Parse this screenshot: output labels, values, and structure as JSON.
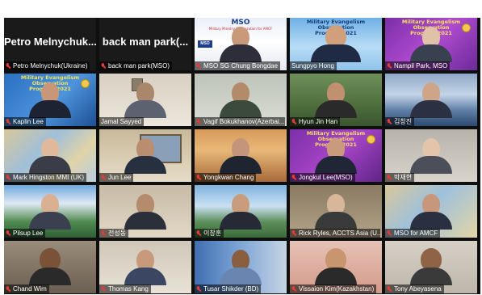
{
  "meeting": {
    "participants": [
      {
        "id": "p1",
        "label": "Petro Melnychuk(Ukraine)",
        "display_name": "Petro Melnychuk...",
        "video": false
      },
      {
        "id": "p2",
        "label": "back man park(MSO)",
        "display_name": "back man park(...",
        "video": false
      },
      {
        "id": "p3",
        "label": "MSO SG Chung Bongdae",
        "video": true,
        "banner_title": "MSO",
        "banner_sub": "Military Ministry Organization for AMCF"
      },
      {
        "id": "p4",
        "label": "Sungpyo Hong",
        "video": true,
        "active_speaker": true,
        "banner_title": "Military Evangelism Observation",
        "banner_sub": "Program 2021"
      },
      {
        "id": "p5",
        "label": "Nampil Park, MSO",
        "video": true,
        "banner_title": "Military Evangelism Observation",
        "banner_sub": "Program 2021"
      },
      {
        "id": "p6",
        "label": "Kaplin Lee",
        "video": true,
        "banner_title": "Military Evangelism Observation",
        "banner_sub": "Program 2021"
      },
      {
        "id": "p7",
        "label": "Jamal Sayyed",
        "video": true
      },
      {
        "id": "p8",
        "label": "Vagif Bokukhanov(Azerbai...",
        "video": true
      },
      {
        "id": "p9",
        "label": "Hyun Jin Han",
        "video": true
      },
      {
        "id": "p10",
        "label": "김창진",
        "video": true
      },
      {
        "id": "p11",
        "label": "Mark Hingston MMI (UK)",
        "video": true
      },
      {
        "id": "p12",
        "label": "Jun Lee",
        "video": true
      },
      {
        "id": "p13",
        "label": "Yongkwan Chang",
        "video": true
      },
      {
        "id": "p14",
        "label": "Jongkul Lee(MSO)",
        "video": true,
        "banner_title": "Military Evangelism Observation",
        "banner_sub": "Program 2021"
      },
      {
        "id": "p15",
        "label": "박재현",
        "video": true
      },
      {
        "id": "p16",
        "label": "Pilsup Lee",
        "video": true
      },
      {
        "id": "p17",
        "label": "전성동",
        "video": true
      },
      {
        "id": "p18",
        "label": "이창훈",
        "video": true
      },
      {
        "id": "p19",
        "label": "Rick Ryles, ACCTS Asia (U...",
        "video": true
      },
      {
        "id": "p20",
        "label": "MSO for AMCF",
        "video": true
      },
      {
        "id": "p21",
        "label": "Chand Wim",
        "video": true
      },
      {
        "id": "p22",
        "label": "Thomas Kang",
        "video": true
      },
      {
        "id": "p23",
        "label": "Tusar Shikder (BD)",
        "video": true
      },
      {
        "id": "p24",
        "label": "Vissaion Kim(Kazakhstan)",
        "video": true
      },
      {
        "id": "p25",
        "label": "Tony Abeyasena",
        "video": true
      }
    ]
  },
  "colors": {
    "grid_bg": "#0f0f0f",
    "active_border": "#e8d83a",
    "mute_icon": "#e53935",
    "banner_purple": "#7b2fa8",
    "banner_blue": "#1f5fb0"
  },
  "icons": {
    "mute": "muted-mic-icon",
    "logo": "mso-logo-icon",
    "emblem": "emblem-badge-icon"
  }
}
